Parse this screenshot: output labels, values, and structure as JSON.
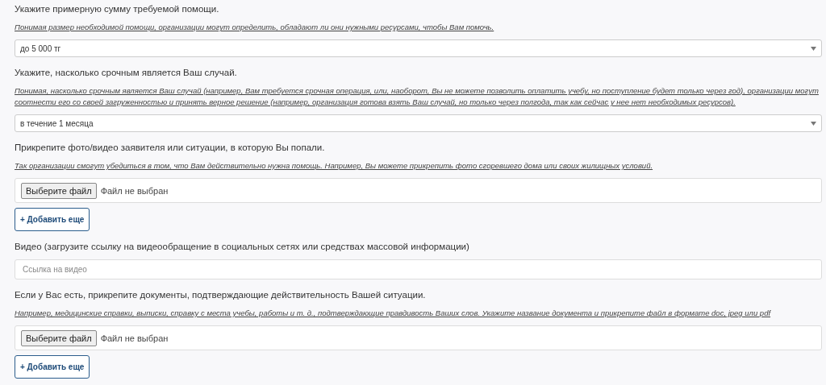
{
  "sections": [
    {
      "kind": "select",
      "label": "Укажите примерную сумму требуемой помощи.",
      "hint": "Понимая размер необходимой помощи, организации могут определить, обладают ли они нужными ресурсами, чтобы Вам помочь.",
      "value": "до 5 000 тг"
    },
    {
      "kind": "select",
      "label": "Укажите, насколько срочным является Ваш случай.",
      "hint": "Понимая, насколько срочным является Ваш случай (например, Вам требуется срочная операция, или, наоборот, Вы не можете позволить оплатить учебу, но поступление будет только через год), организации могут соотнести его со своей загруженностью и принять верное решение (например, организация готова взять Ваш случай, но только через полгода, так как сейчас у нее нет необходимых ресурсов).",
      "value": "в течение 1 месяца"
    },
    {
      "kind": "file",
      "label": "Прикрепите фото/видео заявителя или ситуации, в которую Вы попали.",
      "hint": "Так организации смогут убедиться в том, что Вам действительно нужна помощь. Например, Вы можете прикрепить фото сгоревшего дома или своих жилищных условий.",
      "button": "Выберите файл",
      "status": "Файл не выбран",
      "add_button": "+ Добавить еще"
    },
    {
      "kind": "text",
      "label": "Видео (загрузите ссылку на видеообращение в социальных сетях или средствах массовой информации)",
      "placeholder": "Ссылка на видео"
    },
    {
      "kind": "file",
      "label": "Если у Вас есть, прикрепите документы, подтверждающие действительность Вашей ситуации.",
      "hint": "Например, медицинские справки, выписки, справку с места учебы, работы и т. д., подтверждающие правдивость Ваших слов. Укажите название документа и прикрепите файл в формате doc, jpeg или pdf",
      "button": "Выберите файл",
      "status": "Файл не выбран",
      "add_button": "+ Добавить еще"
    }
  ]
}
